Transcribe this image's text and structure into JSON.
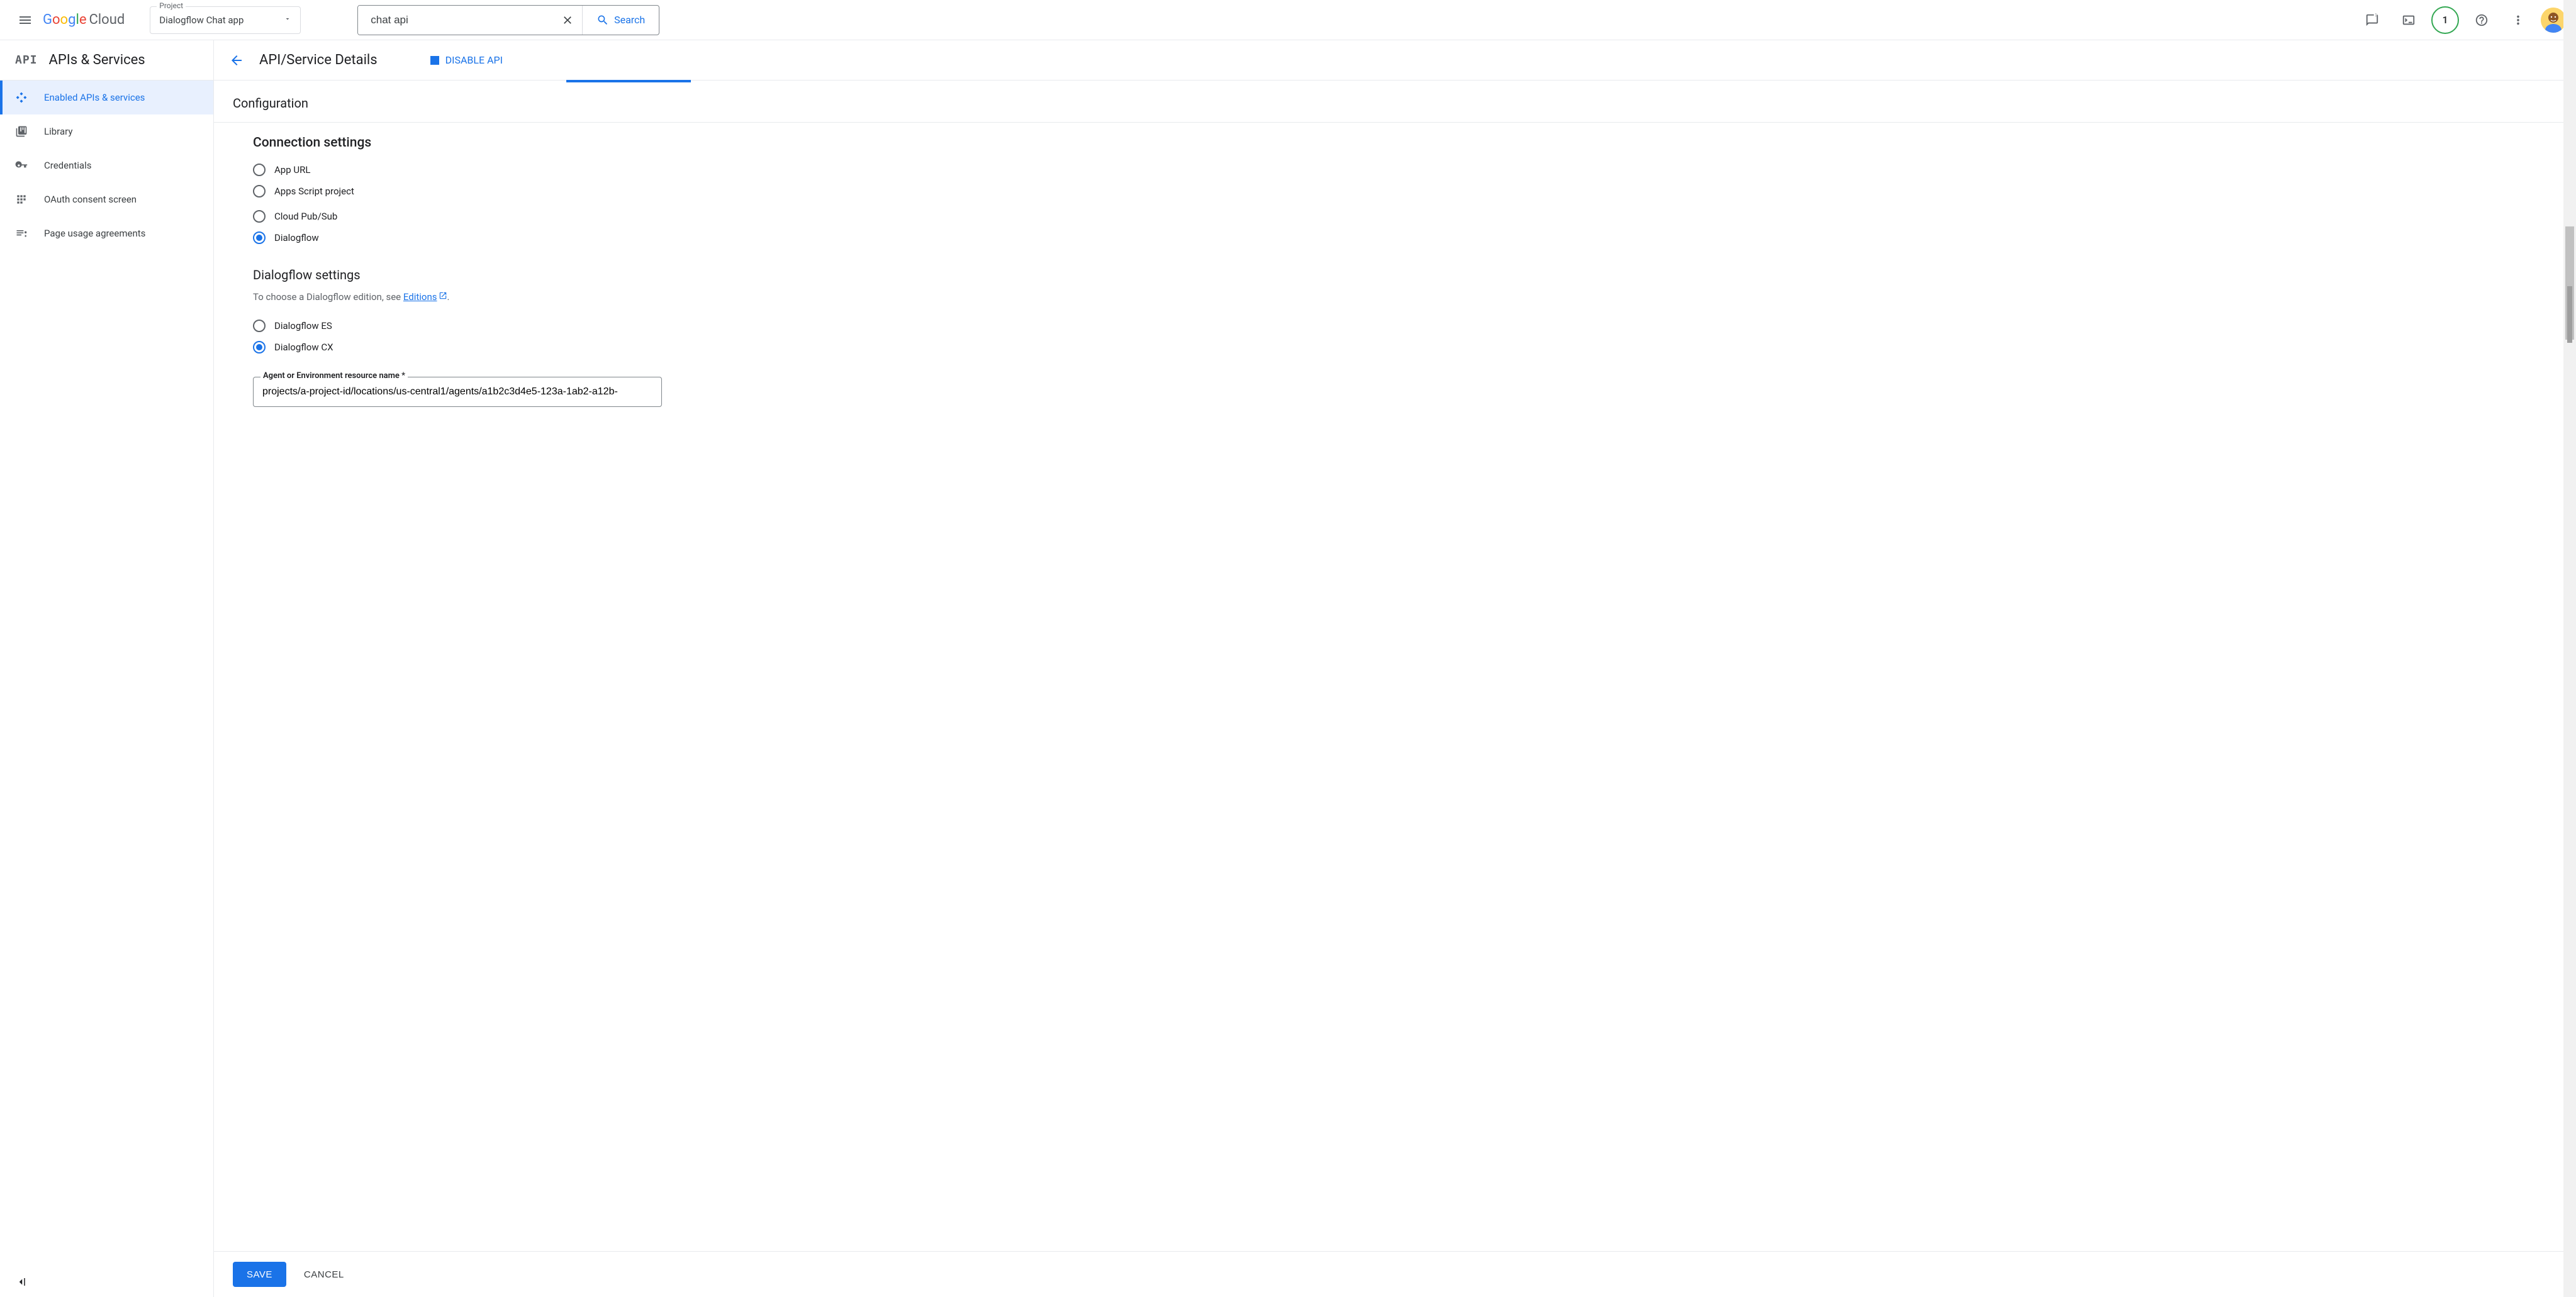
{
  "header": {
    "logo_cloud": "Cloud",
    "project_label": "Project",
    "project_value": "Dialogflow Chat app",
    "search_value": "chat api",
    "search_button": "Search",
    "trial_count": "1"
  },
  "sidebar": {
    "title": "APIs & Services",
    "items": [
      {
        "label": "Enabled APIs & services"
      },
      {
        "label": "Library"
      },
      {
        "label": "Credentials"
      },
      {
        "label": "OAuth consent screen"
      },
      {
        "label": "Page usage agreements"
      }
    ]
  },
  "page": {
    "title": "API/Service Details",
    "disable_label": "DISABLE API",
    "section": "Configuration",
    "connection_title": "Connection settings",
    "connection_options": [
      {
        "label": "App URL"
      },
      {
        "label": "Apps Script project"
      },
      {
        "label": "Cloud Pub/Sub"
      },
      {
        "label": "Dialogflow"
      }
    ],
    "dialogflow_title": "Dialogflow settings",
    "dialogflow_hint_pre": "To choose a Dialogflow edition, see ",
    "dialogflow_hint_link": "Editions",
    "dialogflow_hint_post": ".",
    "dialogflow_options": [
      {
        "label": "Dialogflow ES"
      },
      {
        "label": "Dialogflow CX"
      }
    ],
    "agent_label": "Agent or Environment resource name *",
    "agent_value": "projects/a-project-id/locations/us-central1/agents/a1b2c3d4e5-123a-1ab2-a12b-",
    "save": "SAVE",
    "cancel": "CANCEL"
  }
}
